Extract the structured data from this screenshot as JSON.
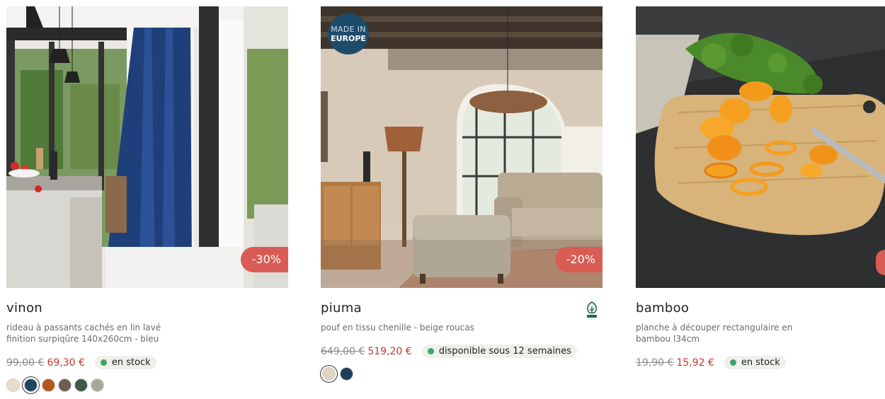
{
  "products": [
    {
      "name": "vinon",
      "description": "rideau à passants cachés en lin lavé finition surpiqûre 140x260cm - bleu",
      "old_price": "99,00 €",
      "new_price": "69,30 €",
      "stock": "en stock",
      "discount": "-30%",
      "image_alt": "blue linen curtain in a modern kitchen",
      "swatches": [
        "#e8dccb",
        "#1f4663",
        "#b4571b",
        "#6e5e52",
        "#3f5a48",
        "#a5aa98"
      ],
      "selected_swatch": 1
    },
    {
      "name": "piuma",
      "description": "pouf en tissu chenille - beige roucas",
      "old_price": "649,00 €",
      "new_price": "519,20 €",
      "stock": "disponible sous 12 semaines",
      "discount": "-20%",
      "badge_line1": "MADE IN",
      "badge_line2": "EUROPE",
      "image_alt": "beige chenille ottoman in a rustic living room",
      "swatches": [
        "#e1d3c2",
        "#1b3f57"
      ],
      "selected_swatch": 0,
      "certification_icon": "fsc-tree-icon"
    },
    {
      "name": "bamboo",
      "description": "planche à découper rectangulaire en bambou l34cm",
      "old_price": "19,90 €",
      "new_price": "15,92 €",
      "stock": "en stock",
      "image_alt": "bamboo cutting board with orange peppers"
    }
  ],
  "colors": {
    "discount_badge": "#d95c54",
    "sale_price": "#c0392b",
    "stock_dot": "#3fa46a",
    "made_in_badge": "#1d4b6a"
  }
}
